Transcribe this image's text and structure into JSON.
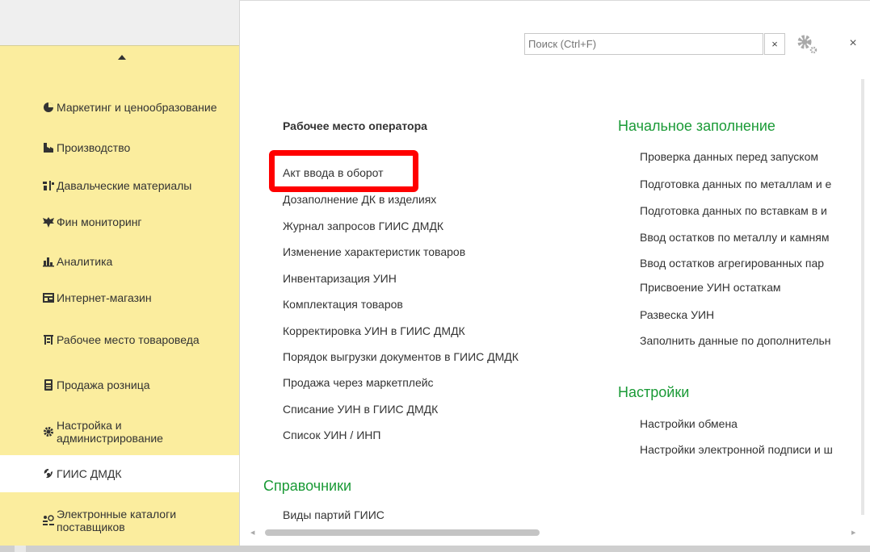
{
  "sidebar": {
    "items": [
      {
        "label": "Маркетинг и ценообразование",
        "icon": "pie-chart-icon"
      },
      {
        "label": "Производство",
        "icon": "factory-icon"
      },
      {
        "label": "Давальческие материалы",
        "icon": "tools-icon"
      },
      {
        "label": "Фин мониторинг",
        "icon": "eagle-icon"
      },
      {
        "label": "Аналитика",
        "icon": "bar-chart-icon"
      },
      {
        "label": "Интернет-магазин",
        "icon": "store-icon"
      },
      {
        "label": "Рабочее место товароведа",
        "icon": "shelves-icon"
      },
      {
        "label": "Продажа розница",
        "icon": "cash-register-icon"
      },
      {
        "label": "Настройка и администрирование",
        "icon": "gear-icon"
      },
      {
        "label": "ГИИС ДМДК",
        "icon": "gem-icon",
        "active": true
      },
      {
        "label": "Электронные каталоги поставщиков",
        "icon": "catalog-icon"
      }
    ]
  },
  "search": {
    "placeholder": "Поиск (Ctrl+F)",
    "clear_label": "×"
  },
  "close_label": "×",
  "main": {
    "operator_heading": "Рабочее место оператора",
    "operator_links": [
      "Акт ввода в оборот",
      "Дозаполнение ДК в изделиях",
      "Журнал запросов ГИИС ДМДК",
      "Изменение характеристик товаров",
      "Инвентаризация УИН",
      "Комплектация товаров",
      "Корректировка УИН в ГИИС ДМДК",
      "Порядок выгрузки документов в ГИИС ДМДК",
      "Продажа через маркетплейс",
      "Списание УИН в ГИИС ДМДК",
      "Список УИН / ИНП"
    ],
    "reference_title": "Справочники",
    "reference_links": [
      "Виды партий ГИИС"
    ],
    "initial_title": "Начальное заполнение",
    "initial_links": [
      "Проверка данных перед запуском",
      "Подготовка данных по металлам и е",
      "Подготовка данных по вставкам в и",
      "Ввод остатков по металлу и камням",
      "Ввод остатков агрегированных пар",
      "Присвоение УИН остаткам",
      "Развеска УИН",
      "Заполнить данные по дополнительн"
    ],
    "settings_title": "Настройки",
    "settings_links": [
      "Настройки обмена",
      "Настройки электронной подписи и ш"
    ]
  },
  "colors": {
    "sidebar_bg": "#fbed9e",
    "section_green": "#1a9a36",
    "highlight_red": "#ff0000"
  }
}
